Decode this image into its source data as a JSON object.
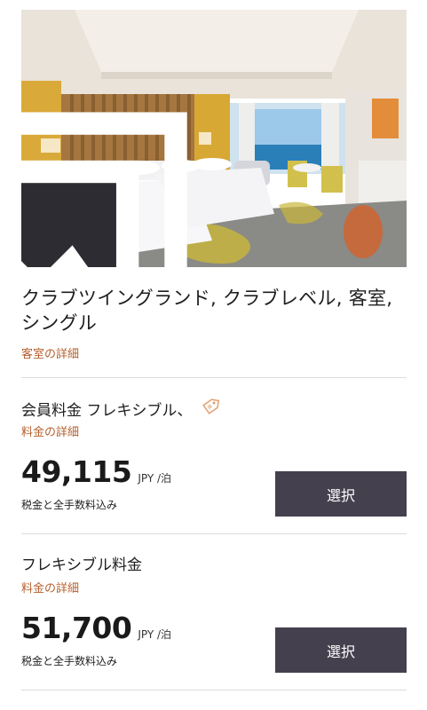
{
  "room": {
    "image_alt_icon": "gallery-icon",
    "title": "クラブツイングランド, クラブレベル, 客室, シングル",
    "details_link": "客室の詳細"
  },
  "rates": [
    {
      "name": "会員料金 フレキシブル、",
      "tag_icon": "member-tag-icon",
      "details_link": "料金の詳細",
      "price": "49,115",
      "unit": "JPY /泊",
      "tax_note": "税金と全手数料込み",
      "button": "選択"
    },
    {
      "name": "フレキシブル料金",
      "details_link": "料金の詳細",
      "price": "51,700",
      "unit": "JPY /泊",
      "tax_note": "税金と全手数料込み",
      "button": "選択"
    }
  ],
  "colors": {
    "accent_link": "#b5602e",
    "button_bg": "#45404e",
    "divider": "#dcdcdc",
    "tag_icon": "#e0a070"
  }
}
